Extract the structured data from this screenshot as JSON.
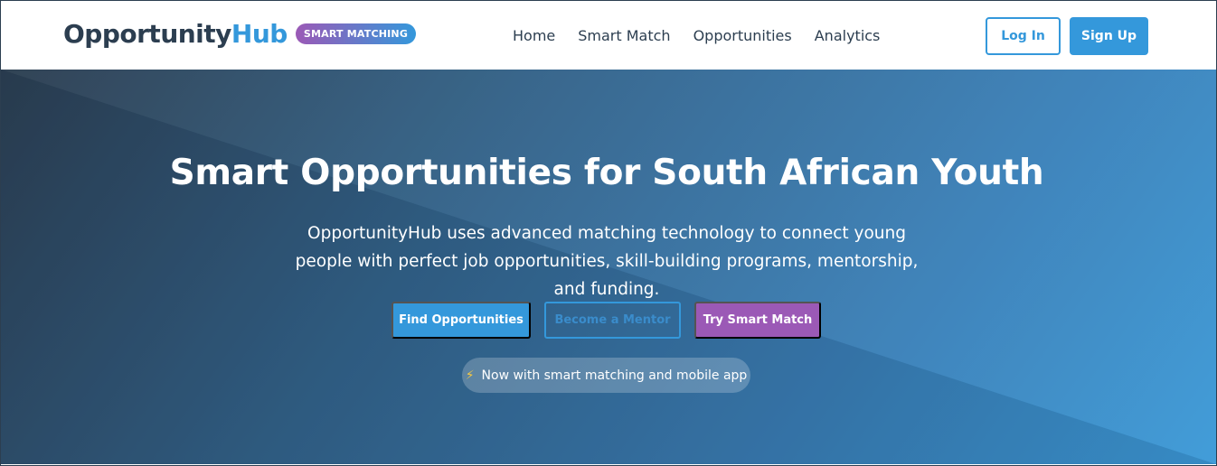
{
  "brand": {
    "name_part1": "Opportunity",
    "name_part2": "Hub",
    "badge": "SMART MATCHING",
    "colors": {
      "dark": "#2c3e50",
      "accent": "#3498db",
      "purple": "#9b59b6"
    }
  },
  "nav": {
    "links": [
      "Home",
      "Smart Match",
      "Opportunities",
      "Analytics"
    ],
    "login_label": "Log In",
    "signup_label": "Sign Up"
  },
  "hero": {
    "title": "Smart Opportunities for South African Youth",
    "description": "OpportunityHub uses advanced matching technology to connect young people with perfect job opportunities, skill-building programs, mentorship, and funding.",
    "buttons": {
      "find": "Find Opportunities",
      "mentor": "Become a Mentor",
      "smart": "Try Smart Match"
    },
    "pill_icon": "lightning-bolt-icon",
    "pill_text": "Now with smart matching and mobile app"
  }
}
